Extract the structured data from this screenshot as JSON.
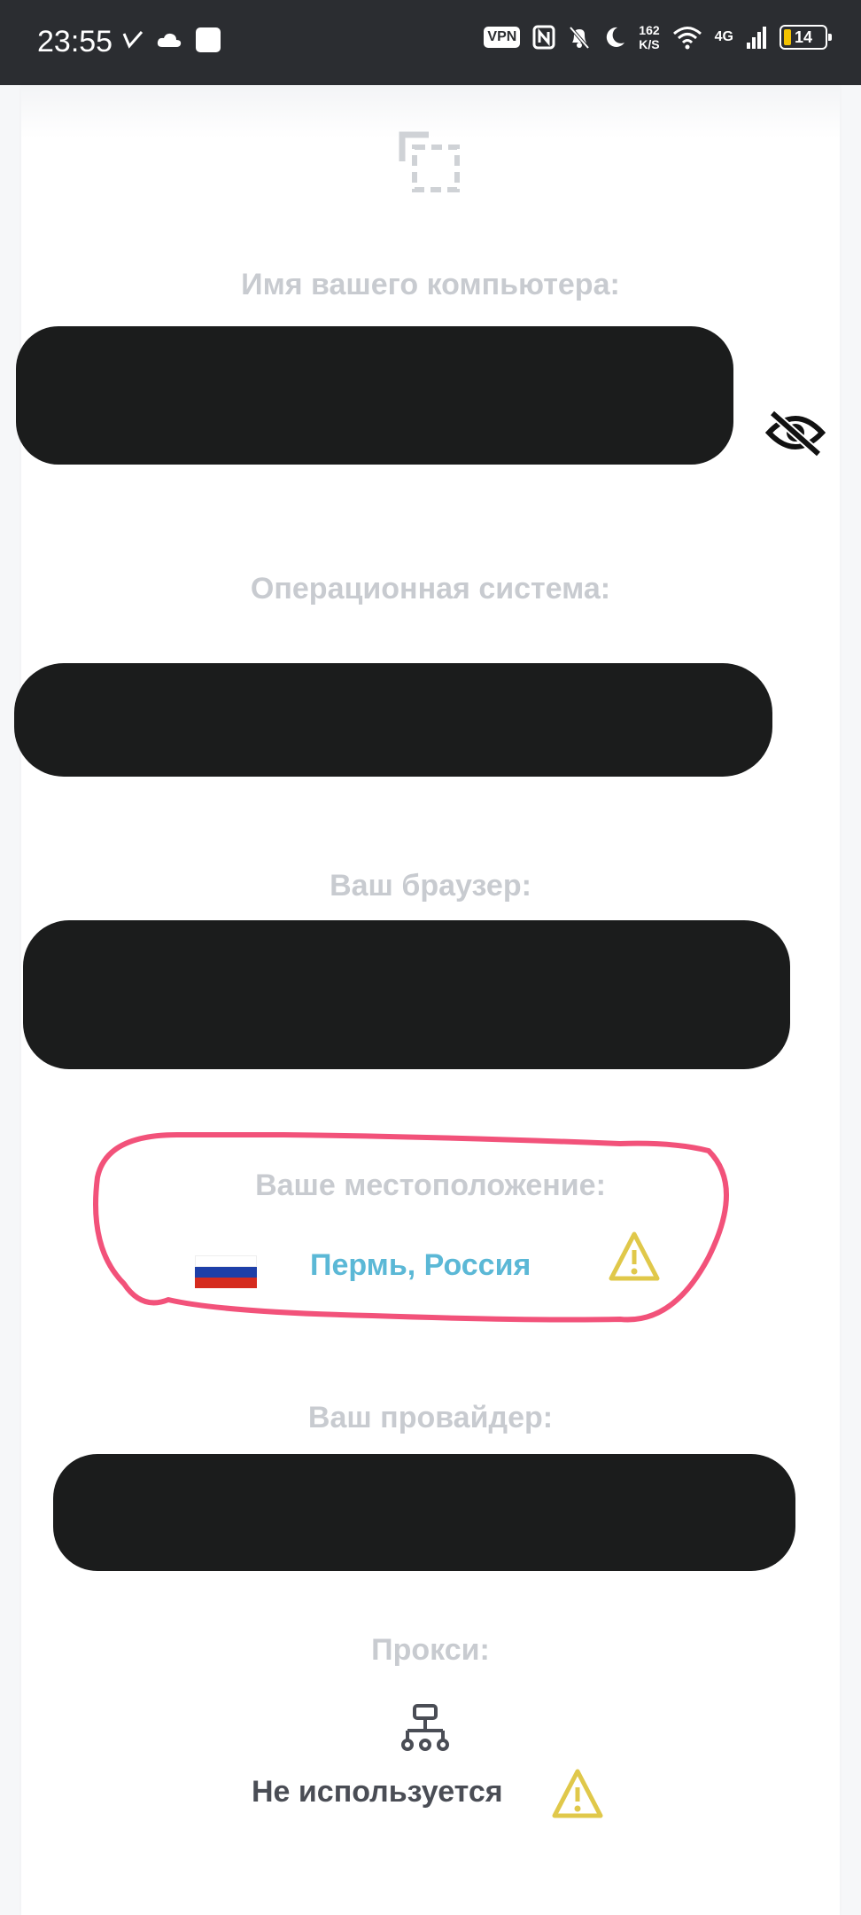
{
  "status_bar": {
    "time": "23:55",
    "vpn": "VPN",
    "speed_value": "162",
    "speed_unit": "K/S",
    "network": "4G",
    "battery": "14"
  },
  "fields": {
    "computer_name_label": "Имя вашего компьютера:",
    "os_label": "Операционная система:",
    "browser_label": "Ваш браузер:",
    "location_label": "Ваше местоположение:",
    "location_value": "Пермь, Россия",
    "provider_label": "Ваш провайдер:",
    "proxy_label": "Прокси:",
    "proxy_value": "Не используется"
  },
  "colors": {
    "label": "#c8cbd0",
    "location_value": "#5bb8d6",
    "warning": "#e0c84a",
    "highlight": "#f2527a"
  },
  "icons": [
    "copy-icon",
    "eye-off-icon",
    "russia-flag-icon",
    "warning-icon",
    "network-icon"
  ]
}
